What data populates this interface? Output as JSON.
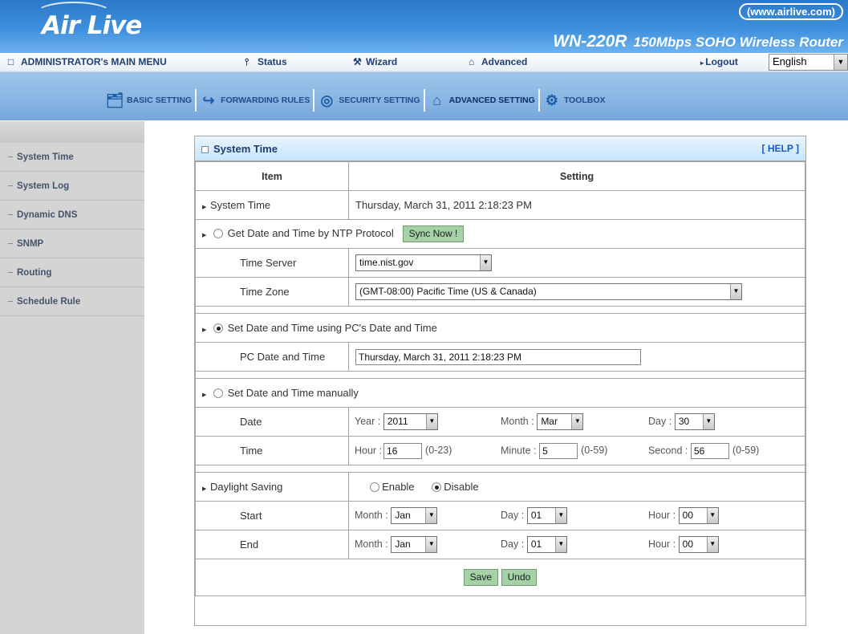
{
  "header": {
    "logo": "Air Live",
    "site": "(www.airlive.com)",
    "model": "WN-220R",
    "tagline": "150Mbps SOHO Wireless Router"
  },
  "menubar": {
    "main_menu": "ADMINISTRATOR's MAIN MENU",
    "status": "Status",
    "wizard": "Wizard",
    "advanced": "Advanced",
    "logout": "Logout",
    "language": "English"
  },
  "tabs": {
    "basic": "BASIC SETTING",
    "forwarding": "FORWARDING RULES",
    "security": "SECURITY SETTING",
    "advanced": "ADVANCED SETTING",
    "toolbox": "TOOLBOX"
  },
  "sidebar": {
    "items": [
      "System Time",
      "System Log",
      "Dynamic DNS",
      "SNMP",
      "Routing",
      "Schedule Rule"
    ]
  },
  "panel": {
    "title": "System Time",
    "help": "[ HELP ]",
    "col_item": "Item",
    "col_setting": "Setting",
    "system_time_label": "System Time",
    "system_time_value": "Thursday, March 31, 2011 2:18:23 PM",
    "ntp_label": "Get Date and Time by NTP Protocol",
    "sync_button": "Sync Now !",
    "time_server_label": "Time Server",
    "time_server_value": "time.nist.gov",
    "time_zone_label": "Time Zone",
    "time_zone_value": "(GMT-08:00) Pacific Time (US & Canada)",
    "pc_label": "Set Date and Time using PC's Date and Time",
    "pc_time_label": "PC Date and Time",
    "pc_time_value": "Thursday, March 31, 2011 2:18:23 PM",
    "manual_label": "Set Date and Time manually",
    "date_label": "Date",
    "year_label": "Year :",
    "year_value": "2011",
    "month_label": "Month :",
    "month_value": "Mar",
    "day_label": "Day :",
    "day_value": "30",
    "time_label": "Time",
    "hour_label": "Hour :",
    "hour_value": "16",
    "hour_range": "(0-23)",
    "minute_label": "Minute :",
    "minute_value": "5",
    "minute_range": "(0-59)",
    "second_label": "Second :",
    "second_value": "56",
    "second_range": "(0-59)",
    "dst_label": "Daylight Saving",
    "enable_label": "Enable",
    "disable_label": "Disable",
    "start_label": "Start",
    "end_label": "End",
    "start_month": "Jan",
    "start_day": "01",
    "start_hour": "00",
    "end_month": "Jan",
    "end_day": "01",
    "end_hour": "00",
    "dst_month_label": "Month :",
    "dst_day_label": "Day :",
    "dst_hour_label": "Hour :",
    "save_button": "Save",
    "undo_button": "Undo"
  }
}
